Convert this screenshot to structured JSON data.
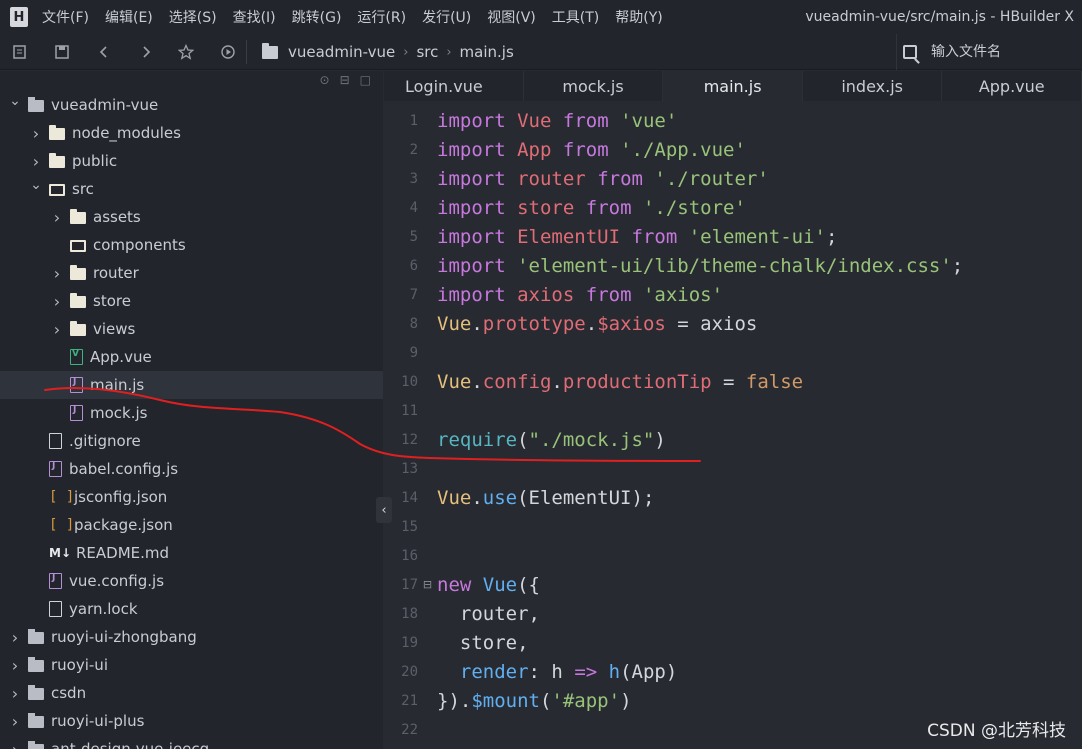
{
  "menubar": {
    "logo": "H",
    "items": [
      "文件(F)",
      "编辑(E)",
      "选择(S)",
      "查找(I)",
      "跳转(G)",
      "运行(R)",
      "发行(U)",
      "视图(V)",
      "工具(T)",
      "帮助(Y)"
    ],
    "window_title": "vueadmin-vue/src/main.js - HBuilder X"
  },
  "toolbar": {
    "breadcrumb": [
      "vueadmin-vue",
      "src",
      "main.js"
    ],
    "file_search_placeholder": "输入文件名"
  },
  "sidebar": {
    "tree": [
      {
        "label": "vueadmin-vue",
        "depth": 0,
        "arrow": "open",
        "icon": "project-icon"
      },
      {
        "label": "node_modules",
        "depth": 1,
        "arrow": "closed",
        "icon": "folder-icon"
      },
      {
        "label": "public",
        "depth": 1,
        "arrow": "closed",
        "icon": "folder-icon"
      },
      {
        "label": "src",
        "depth": 1,
        "arrow": "open",
        "icon": "folder-open-icon"
      },
      {
        "label": "assets",
        "depth": 2,
        "arrow": "closed",
        "icon": "folder-icon"
      },
      {
        "label": "components",
        "depth": 2,
        "arrow": "none",
        "icon": "folder-open-icon"
      },
      {
        "label": "router",
        "depth": 2,
        "arrow": "closed",
        "icon": "folder-icon"
      },
      {
        "label": "store",
        "depth": 2,
        "arrow": "closed",
        "icon": "folder-icon"
      },
      {
        "label": "views",
        "depth": 2,
        "arrow": "closed",
        "icon": "folder-icon"
      },
      {
        "label": "App.vue",
        "depth": 2,
        "arrow": "none",
        "icon": "vue-file-icon"
      },
      {
        "label": "main.js",
        "depth": 2,
        "arrow": "none",
        "icon": "js-file-icon",
        "selected": true
      },
      {
        "label": "mock.js",
        "depth": 2,
        "arrow": "none",
        "icon": "js-file-icon"
      },
      {
        "label": ".gitignore",
        "depth": 1,
        "arrow": "none",
        "icon": "file-icon"
      },
      {
        "label": "babel.config.js",
        "depth": 1,
        "arrow": "none",
        "icon": "js-file-icon"
      },
      {
        "label": "jsconfig.json",
        "depth": 1,
        "arrow": "none",
        "icon": "json-file-icon"
      },
      {
        "label": "package.json",
        "depth": 1,
        "arrow": "none",
        "icon": "json-file-icon"
      },
      {
        "label": "README.md",
        "depth": 1,
        "arrow": "none",
        "icon": "markdown-file-icon"
      },
      {
        "label": "vue.config.js",
        "depth": 1,
        "arrow": "none",
        "icon": "js-file-icon"
      },
      {
        "label": "yarn.lock",
        "depth": 1,
        "arrow": "none",
        "icon": "file-icon"
      },
      {
        "label": "ruoyi-ui-zhongbang",
        "depth": 0,
        "arrow": "closed",
        "icon": "project-icon"
      },
      {
        "label": "ruoyi-ui",
        "depth": 0,
        "arrow": "closed",
        "icon": "project-icon"
      },
      {
        "label": "csdn",
        "depth": 0,
        "arrow": "closed",
        "icon": "project-icon"
      },
      {
        "label": "ruoyi-ui-plus",
        "depth": 0,
        "arrow": "closed",
        "icon": "project-icon"
      },
      {
        "label": "ant-design-vue-jeecg",
        "depth": 0,
        "arrow": "closed",
        "icon": "project-icon"
      }
    ]
  },
  "tabs": [
    {
      "label": "Login.vue",
      "active": false
    },
    {
      "label": "mock.js",
      "active": false
    },
    {
      "label": "main.js",
      "active": true
    },
    {
      "label": "index.js",
      "active": false
    },
    {
      "label": "App.vue",
      "active": false
    }
  ],
  "editor": {
    "lines": [
      {
        "n": "1",
        "tokens": [
          [
            "kw",
            "import"
          ],
          [
            "p",
            " "
          ],
          [
            "id",
            "Vue"
          ],
          [
            "p",
            " "
          ],
          [
            "kw",
            "from"
          ],
          [
            "p",
            " "
          ],
          [
            "str",
            "'vue'"
          ]
        ]
      },
      {
        "n": "2",
        "tokens": [
          [
            "kw",
            "import"
          ],
          [
            "p",
            " "
          ],
          [
            "id",
            "App"
          ],
          [
            "p",
            " "
          ],
          [
            "kw",
            "from"
          ],
          [
            "p",
            " "
          ],
          [
            "str",
            "'./App.vue'"
          ]
        ]
      },
      {
        "n": "3",
        "tokens": [
          [
            "kw",
            "import"
          ],
          [
            "p",
            " "
          ],
          [
            "id",
            "router"
          ],
          [
            "p",
            " "
          ],
          [
            "kw",
            "from"
          ],
          [
            "p",
            " "
          ],
          [
            "str",
            "'./router'"
          ]
        ]
      },
      {
        "n": "4",
        "tokens": [
          [
            "kw",
            "import"
          ],
          [
            "p",
            " "
          ],
          [
            "id",
            "store"
          ],
          [
            "p",
            " "
          ],
          [
            "kw",
            "from"
          ],
          [
            "p",
            " "
          ],
          [
            "str",
            "'./store'"
          ]
        ]
      },
      {
        "n": "5",
        "tokens": [
          [
            "kw",
            "import"
          ],
          [
            "p",
            " "
          ],
          [
            "id",
            "ElementUI"
          ],
          [
            "p",
            " "
          ],
          [
            "kw",
            "from"
          ],
          [
            "p",
            " "
          ],
          [
            "str",
            "'element-ui'"
          ],
          [
            "p",
            ";"
          ]
        ]
      },
      {
        "n": "6",
        "tokens": [
          [
            "kw",
            "import"
          ],
          [
            "p",
            " "
          ],
          [
            "str",
            "'element-ui/lib/theme-chalk/index.css'"
          ],
          [
            "p",
            ";"
          ]
        ]
      },
      {
        "n": "7",
        "tokens": [
          [
            "kw",
            "import"
          ],
          [
            "p",
            " "
          ],
          [
            "id",
            "axios"
          ],
          [
            "p",
            " "
          ],
          [
            "kw",
            "from"
          ],
          [
            "p",
            " "
          ],
          [
            "str",
            "'axios'"
          ]
        ]
      },
      {
        "n": "8",
        "tokens": [
          [
            "cls",
            "Vue"
          ],
          [
            "p",
            "."
          ],
          [
            "prop",
            "prototype"
          ],
          [
            "p",
            "."
          ],
          [
            "prop",
            "$axios"
          ],
          [
            "p",
            " = axios"
          ]
        ]
      },
      {
        "n": "9",
        "tokens": []
      },
      {
        "n": "10",
        "tokens": [
          [
            "cls",
            "Vue"
          ],
          [
            "p",
            "."
          ],
          [
            "prop",
            "config"
          ],
          [
            "p",
            "."
          ],
          [
            "prop",
            "productionTip"
          ],
          [
            "p",
            " = "
          ],
          [
            "bool",
            "false"
          ]
        ]
      },
      {
        "n": "11",
        "tokens": []
      },
      {
        "n": "12",
        "tokens": [
          [
            "req",
            "require"
          ],
          [
            "p",
            "("
          ],
          [
            "str",
            "\"./mock.js\""
          ],
          [
            "p",
            ")"
          ]
        ]
      },
      {
        "n": "13",
        "tokens": []
      },
      {
        "n": "14",
        "tokens": [
          [
            "cls",
            "Vue"
          ],
          [
            "p",
            "."
          ],
          [
            "fn",
            "use"
          ],
          [
            "p",
            "(ElementUI);"
          ]
        ]
      },
      {
        "n": "15",
        "tokens": []
      },
      {
        "n": "16",
        "tokens": []
      },
      {
        "n": "17",
        "fold": "⊟",
        "tokens": [
          [
            "kw",
            "new"
          ],
          [
            "p",
            " "
          ],
          [
            "fn",
            "Vue"
          ],
          [
            "p",
            "({"
          ]
        ]
      },
      {
        "n": "18",
        "tokens": [
          [
            "p",
            "  router,"
          ]
        ]
      },
      {
        "n": "19",
        "tokens": [
          [
            "p",
            "  store,"
          ]
        ]
      },
      {
        "n": "20",
        "tokens": [
          [
            "p",
            "  "
          ],
          [
            "fn",
            "render"
          ],
          [
            "p",
            ": "
          ],
          [
            "p",
            "h "
          ],
          [
            "kw",
            "=>"
          ],
          [
            "p",
            " "
          ],
          [
            "fn",
            "h"
          ],
          [
            "p",
            "(App)"
          ]
        ]
      },
      {
        "n": "21",
        "tokens": [
          [
            "p",
            "})."
          ],
          [
            "fn",
            "$mount"
          ],
          [
            "p",
            "("
          ],
          [
            "str",
            "'#app'"
          ],
          [
            "p",
            ")"
          ]
        ]
      },
      {
        "n": "22",
        "tokens": []
      }
    ]
  },
  "watermark": "CSDN @北芳科技",
  "colors": {
    "annotation": "#e02020",
    "background": "#272a31",
    "sidebar": "#22252b"
  }
}
